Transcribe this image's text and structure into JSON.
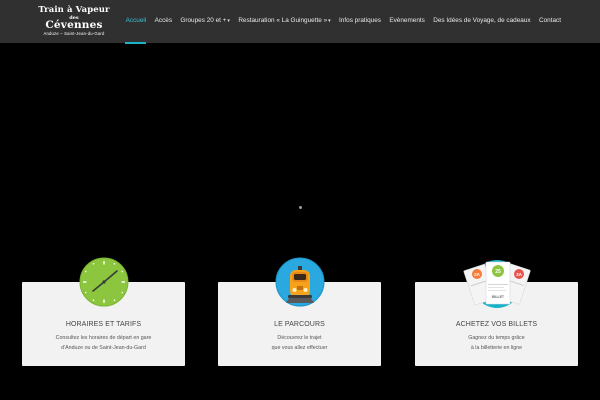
{
  "logo": {
    "line1": "Train à Vapeur",
    "line2": "des",
    "line3": "Cévennes",
    "line4": "Anduze – Saint-Jean-du-Gard"
  },
  "nav": {
    "items": [
      {
        "label": "Accueil"
      },
      {
        "label": "Accès"
      },
      {
        "label": "Groupes 20 et +"
      },
      {
        "label": "Restauration « La Guinguette »"
      },
      {
        "label": "Infos pratiques"
      },
      {
        "label": "Evènements"
      },
      {
        "label": "Des Idées de Voyage, de cadeaux"
      },
      {
        "label": "Contact"
      }
    ],
    "caret": "▾",
    "active_color": "#1ab2c9"
  },
  "cards": [
    {
      "title": "HORAIRES ET TARIFS",
      "desc": "Consultez les horaires de départ en gare\nd'Anduze ou de Saint-Jean-du-Gard",
      "icon": "clock-icon",
      "icon_color": "#8cc63f"
    },
    {
      "title": "LE PARCOURS",
      "desc": "Découvrez le trajet\nque vous allez effectuer",
      "icon": "train-icon",
      "icon_color": "#29a9e0"
    },
    {
      "title": "ACHETEZ VOS BILLETS",
      "desc": "Gagnez du temps grâce\nà la billetterie en ligne",
      "icon": "tickets-icon",
      "icon_color": "#1ab2c9"
    }
  ],
  "tickets": {
    "badges": [
      "2A",
      "25",
      "3A"
    ],
    "ticket_text": "BILLET"
  }
}
